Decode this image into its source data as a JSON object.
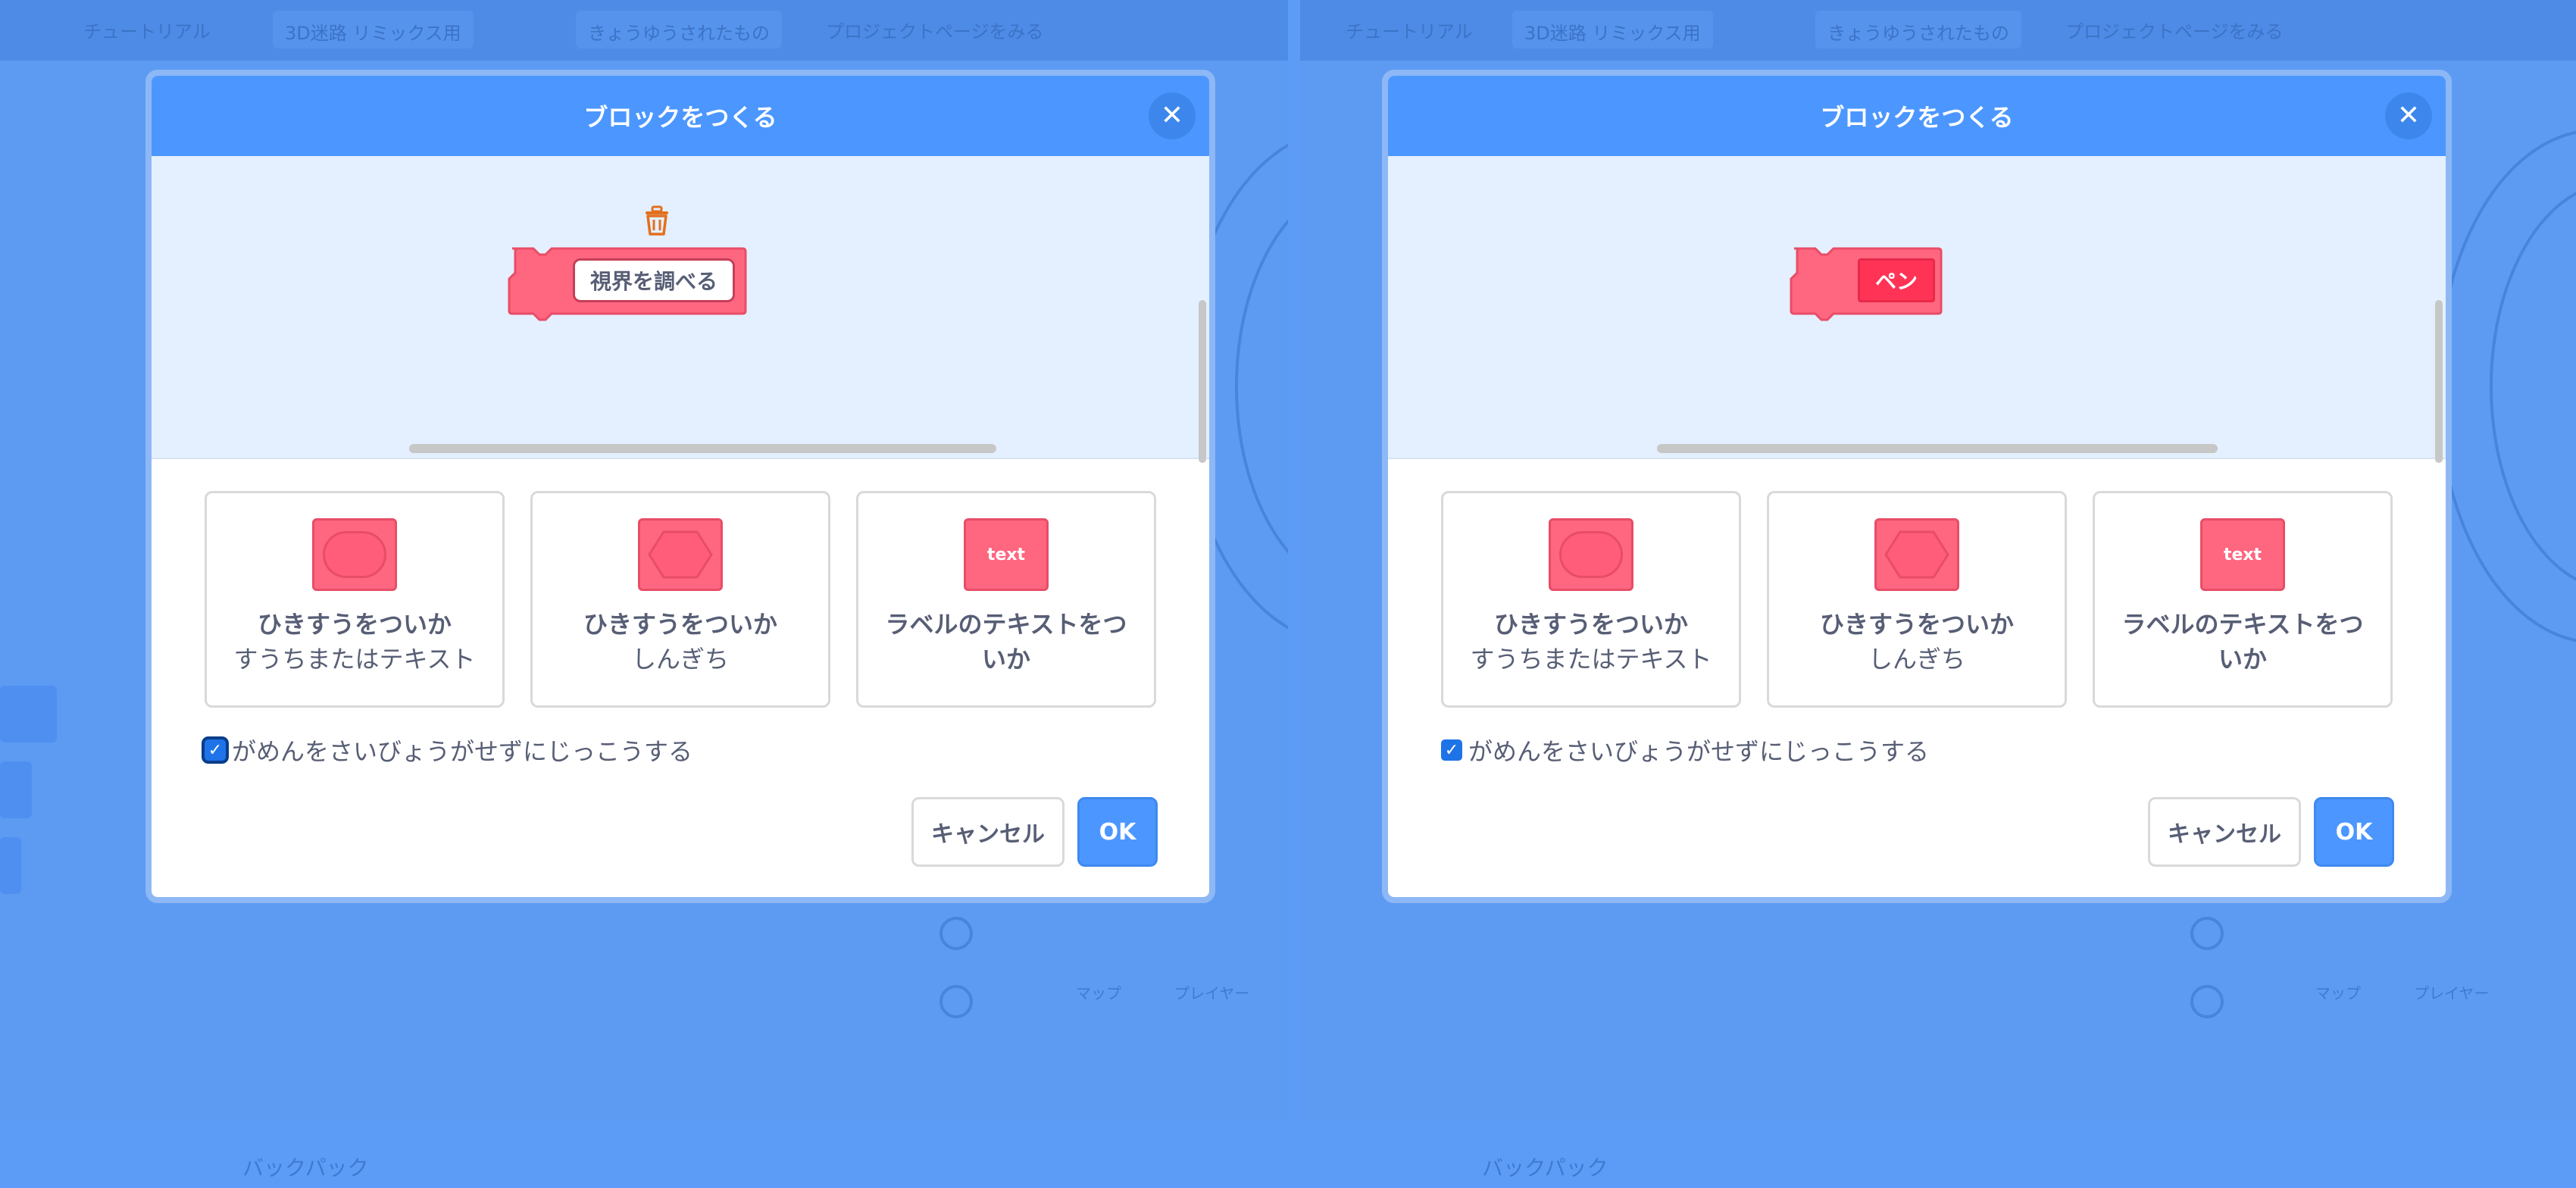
{
  "background": {
    "menu": {
      "tutorial": "チュートリアル",
      "project_title": "3D迷路 リミックス用",
      "shared": "きょうゆうされたもの",
      "see_project_page": "プロジェクトページをみる"
    },
    "backpack_label": "バックパック",
    "sprite_map_label": "マップ",
    "sprite_player_label": "プレイヤー"
  },
  "modals": [
    {
      "title": "ブロックをつくる",
      "close_icon": "close-icon",
      "block_input_text": "視界を調べる",
      "options": [
        {
          "title": "ひきすうをついか",
          "subtitle": "すうちまたはテキスト",
          "icon": "oval-input-icon"
        },
        {
          "title": "ひきすうをついか",
          "subtitle": "しんぎち",
          "icon": "boolean-input-icon"
        },
        {
          "title": "ラベルのテキストをつ",
          "title_line2": "いか",
          "icon": "label-text-icon",
          "icon_text": "text"
        }
      ],
      "checkbox_label": "がめんをさいびょうがせずにじっこうする",
      "checkbox_checked": true,
      "cancel_label": "キャンセル",
      "ok_label": "OK"
    },
    {
      "title": "ブロックをつくる",
      "close_icon": "close-icon",
      "block_label_text": "ペン",
      "options": [
        {
          "title": "ひきすうをついか",
          "subtitle": "すうちまたはテキスト",
          "icon": "oval-input-icon"
        },
        {
          "title": "ひきすうをついか",
          "subtitle": "しんぎち",
          "icon": "boolean-input-icon"
        },
        {
          "title": "ラベルのテキストをつ",
          "title_line2": "いか",
          "icon": "label-text-icon",
          "icon_text": "text"
        }
      ],
      "checkbox_label": "がめんをさいびょうがせずにじっこうする",
      "checkbox_checked": true,
      "cancel_label": "キャンセル",
      "ok_label": "OK"
    }
  ],
  "colors": {
    "accent": "#4c97ff",
    "block": "#ff6680",
    "block_border": "#e84d67",
    "label_field": "#ff3355",
    "trash": "#e2701f"
  }
}
